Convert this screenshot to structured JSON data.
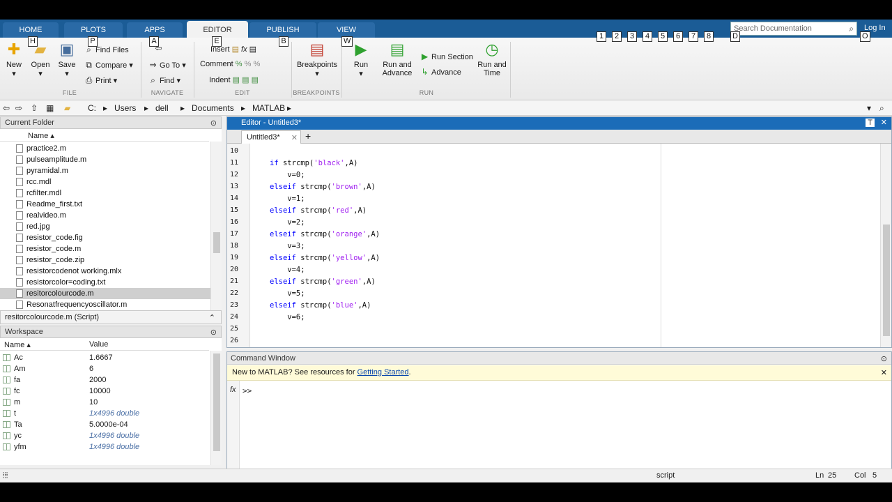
{
  "tabs": [
    {
      "label": "HOME",
      "key": "H"
    },
    {
      "label": "PLOTS",
      "key": "P"
    },
    {
      "label": "APPS",
      "key": "A"
    },
    {
      "label": "EDITOR",
      "key": "E"
    },
    {
      "label": "PUBLISH",
      "key": "B"
    },
    {
      "label": "VIEW",
      "key": "W"
    }
  ],
  "quick_keys": [
    "1",
    "2",
    "3",
    "4",
    "5",
    "6",
    "7",
    "8"
  ],
  "quick_key_d": "D",
  "quick_key_o": "O",
  "search": {
    "placeholder": "Search Documentation"
  },
  "login": "Log In",
  "ribbon": {
    "file": {
      "new": "New",
      "open": "Open",
      "save": "Save",
      "find_files": "Find Files",
      "compare": "Compare",
      "print": "Print",
      "group": "FILE"
    },
    "navigate": {
      "go_to": "Go To",
      "find": "Find",
      "group": "NAVIGATE"
    },
    "edit": {
      "insert": "Insert",
      "comment": "Comment",
      "indent": "Indent",
      "group": "EDIT"
    },
    "breakpoints": {
      "label": "Breakpoints",
      "group": "BREAKPOINTS"
    },
    "run": {
      "run": "Run",
      "run_advance_1": "Run and",
      "run_advance_2": "Advance",
      "run_section": "Run Section",
      "advance": "Advance",
      "run_time_1": "Run and",
      "run_time_2": "Time",
      "group": "RUN"
    }
  },
  "address": [
    "C:",
    "Users",
    "dell",
    "Documents",
    "MATLAB"
  ],
  "current_folder": {
    "title": "Current Folder",
    "column": "Name",
    "files": [
      "practice2.m",
      "pulseamplitude.m",
      "pyramidal.m",
      "rcc.mdl",
      "rcfilter.mdl",
      "Readme_first.txt",
      "realvideo.m",
      "red.jpg",
      "resistor_code.fig",
      "resistor_code.m",
      "resistor_code.zip",
      "resistorcodenot working.mlx",
      "resistorcolor=coding.txt",
      "resitorcolourcode.m",
      "Resonatfrequencyoscillator.m"
    ],
    "selected": "resitorcolourcode.m"
  },
  "details": "resitorcolourcode.m  (Script)",
  "workspace": {
    "title": "Workspace",
    "col_name": "Name",
    "col_value": "Value",
    "vars": [
      {
        "name": "Ac",
        "value": "1.6667",
        "italic": false
      },
      {
        "name": "Am",
        "value": "6",
        "italic": false
      },
      {
        "name": "fa",
        "value": "2000",
        "italic": false
      },
      {
        "name": "fc",
        "value": "10000",
        "italic": false
      },
      {
        "name": "m",
        "value": "10",
        "italic": false
      },
      {
        "name": "t",
        "value": "1x4996 double",
        "italic": true
      },
      {
        "name": "Ta",
        "value": "5.0000e-04",
        "italic": false
      },
      {
        "name": "yc",
        "value": "1x4996 double",
        "italic": true
      },
      {
        "name": "yfm",
        "value": "1x4996 double",
        "italic": true
      }
    ]
  },
  "editor": {
    "title": "Editor - Untitled3*",
    "tab": "Untitled3*",
    "lines": [
      {
        "n": "10",
        "parts": []
      },
      {
        "n": "11",
        "parts": [
          [
            "kw",
            "if"
          ],
          [
            "",
            "strcmp("
          ],
          [
            "str",
            "'black'"
          ],
          [
            "",
            ",A)"
          ]
        ]
      },
      {
        "n": "12",
        "parts": [
          [
            "",
            "    v=0;"
          ]
        ]
      },
      {
        "n": "13",
        "parts": [
          [
            "kw",
            "elseif"
          ],
          [
            "",
            "strcmp("
          ],
          [
            "str",
            "'brown'"
          ],
          [
            "",
            ",A)"
          ]
        ]
      },
      {
        "n": "14",
        "parts": [
          [
            "",
            "    v=1;"
          ]
        ]
      },
      {
        "n": "15",
        "parts": [
          [
            "kw",
            "elseif"
          ],
          [
            "",
            "strcmp("
          ],
          [
            "str",
            "'red'"
          ],
          [
            "",
            ",A)"
          ]
        ]
      },
      {
        "n": "16",
        "parts": [
          [
            "",
            "    v=2;"
          ]
        ]
      },
      {
        "n": "17",
        "parts": [
          [
            "kw",
            "elseif"
          ],
          [
            "",
            "strcmp("
          ],
          [
            "str",
            "'orange'"
          ],
          [
            "",
            ",A)"
          ]
        ]
      },
      {
        "n": "18",
        "parts": [
          [
            "",
            "    v=3;"
          ]
        ]
      },
      {
        "n": "19",
        "parts": [
          [
            "kw",
            "elseif"
          ],
          [
            "",
            "strcmp("
          ],
          [
            "str",
            "'yellow'"
          ],
          [
            "",
            ",A)"
          ]
        ]
      },
      {
        "n": "20",
        "parts": [
          [
            "",
            "    v=4;"
          ]
        ]
      },
      {
        "n": "21",
        "parts": [
          [
            "kw",
            "elseif"
          ],
          [
            "",
            "strcmp("
          ],
          [
            "str",
            "'green'"
          ],
          [
            "",
            ",A)"
          ]
        ]
      },
      {
        "n": "22",
        "parts": [
          [
            "",
            "    v=5;"
          ]
        ]
      },
      {
        "n": "23",
        "parts": [
          [
            "kw",
            "elseif"
          ],
          [
            "",
            "strcmp("
          ],
          [
            "str",
            "'blue'"
          ],
          [
            "",
            ",A)"
          ]
        ]
      },
      {
        "n": "24",
        "parts": [
          [
            "",
            "    v=6;"
          ]
        ]
      },
      {
        "n": "25",
        "parts": []
      },
      {
        "n": "26",
        "parts": []
      }
    ]
  },
  "command_window": {
    "title": "Command Window",
    "notice": "New to MATLAB? See resources for ",
    "notice_link": "Getting Started",
    "notice_end": ".",
    "fx": "fx",
    "prompt": ">>"
  },
  "status": {
    "mode": "script",
    "ln_label": "Ln",
    "ln": "25",
    "col_label": "Col",
    "col": "5"
  },
  "colors": {
    "blue_bar": "#1b5c96",
    "editor_title": "#1b6cb8",
    "keyword": "#0000ff",
    "string": "#a020f0"
  }
}
